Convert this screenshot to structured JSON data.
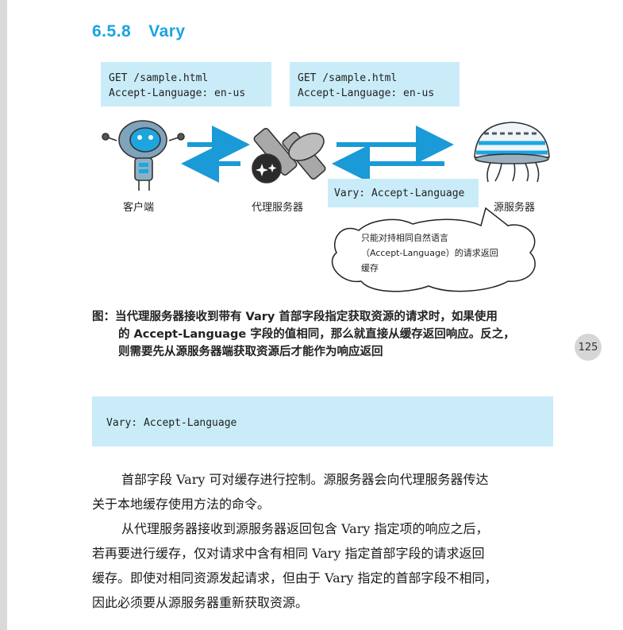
{
  "section": {
    "number": "6.5.8",
    "title": "Vary"
  },
  "diagram": {
    "request_left": {
      "line1": "GET /sample.html",
      "line2": "Accept-Language: en-us"
    },
    "request_right": {
      "line1": "GET /sample.html",
      "line2": "Accept-Language: en-us"
    },
    "response_header": "Vary: Accept-Language",
    "labels": {
      "client": "客户端",
      "proxy": "代理服务器",
      "origin": "源服务器"
    },
    "bubble": {
      "line1": "只能对持相同自然语言",
      "line2": "（Accept-Language）的请求返回",
      "line3": "缓存"
    },
    "colors": {
      "accent": "#1aa3e0",
      "code_bg": "#c9ecf8",
      "arrow": "#1a9ad6"
    }
  },
  "caption": {
    "line1": "图：当代理服务器接收到带有 Vary 首部字段指定获取资源的请求时，如果使用",
    "line2": "的 Accept-Language 字段的值相同，那么就直接从缓存返回响应。反之，",
    "line3": "则需要先从源服务器端获取资源后才能作为响应返回"
  },
  "page_number": "125",
  "code_block": "Vary: Accept-Language",
  "body": {
    "p1_line1": "首部字段 Vary 可对缓存进行控制。源服务器会向代理服务器传达",
    "p1_line2": "关于本地缓存使用方法的命令。",
    "p2_line1": "从代理服务器接收到源服务器返回包含 Vary 指定项的响应之后，",
    "p2_line2": "若再要进行缓存，仅对请求中含有相同 Vary 指定首部字段的请求返回",
    "p2_line3": "缓存。即使对相同资源发起请求，但由于 Vary 指定的首部字段不相同，",
    "p2_line4": "因此必须要从源服务器重新获取资源。"
  }
}
